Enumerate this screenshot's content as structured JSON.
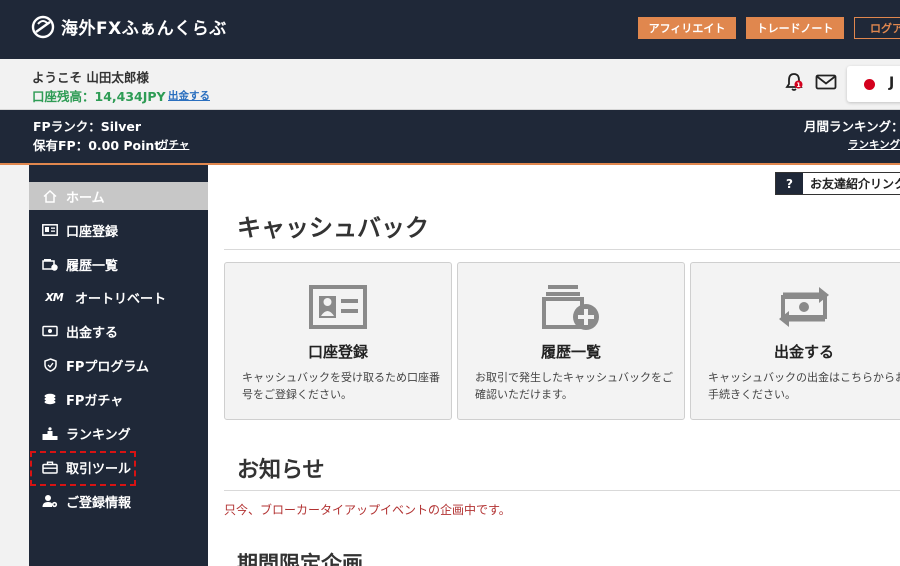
{
  "brand": {
    "name": "海外FXふぁんくらぶ"
  },
  "top_nav": [
    "アフィリエイト",
    "トレードノート",
    "ログア"
  ],
  "user": {
    "greeting": "ようこそ 山田太郎様",
    "balance": "口座残高：14,434JPY",
    "deposit_link": "出金する",
    "notification_count": "1",
    "language": "J"
  },
  "fp": {
    "rank": "FPランク：Silver",
    "points": "保有FP：0.00 Point",
    "gacha_link": "ガチャ",
    "monthly_ranking": "月間ランキング：",
    "ranking_link": "ランキング"
  },
  "sidebar": {
    "items": [
      {
        "label": "ホーム",
        "icon": "home-icon",
        "active": true
      },
      {
        "label": "口座登録",
        "icon": "id-card-icon"
      },
      {
        "label": "履歴一覧",
        "icon": "folder-plus-icon"
      },
      {
        "label": "オートリベート",
        "icon": "xm-logo-icon"
      },
      {
        "label": "出金する",
        "icon": "money-icon"
      },
      {
        "label": "FPプログラム",
        "icon": "shield-icon"
      },
      {
        "label": "FPガチャ",
        "icon": "coins-icon"
      },
      {
        "label": "ランキング",
        "icon": "podium-icon"
      },
      {
        "label": "取引ツール",
        "icon": "toolbox-icon",
        "highlighted": true
      },
      {
        "label": "ご登録情報",
        "icon": "user-gear-icon"
      }
    ]
  },
  "friend_link": {
    "icon_label": "?",
    "label": "お友達紹介リンク"
  },
  "main": {
    "title": "キャッシュバック",
    "cards": [
      {
        "title": "口座登録",
        "desc": "キャッシュバックを受け取るため口座番号をご登録ください。",
        "icon": "id-card-icon"
      },
      {
        "title": "履歴一覧",
        "desc": "お取引で発生したキャッシュバックをご確認いただけます。",
        "icon": "folder-plus-icon"
      },
      {
        "title": "出金する",
        "desc": "キャッシュバックの出金はこちらからお手続きください。",
        "icon": "money-transfer-icon"
      }
    ],
    "news_title": "お知らせ",
    "news_text": "只今、ブローカータイアップイベントの企画中です。",
    "campaign_title": "期間限定企画"
  },
  "colors": {
    "navy": "#1f2838",
    "accent": "#e0874e",
    "balance_green": "#2e9c55",
    "notice_red": "#b23232"
  }
}
